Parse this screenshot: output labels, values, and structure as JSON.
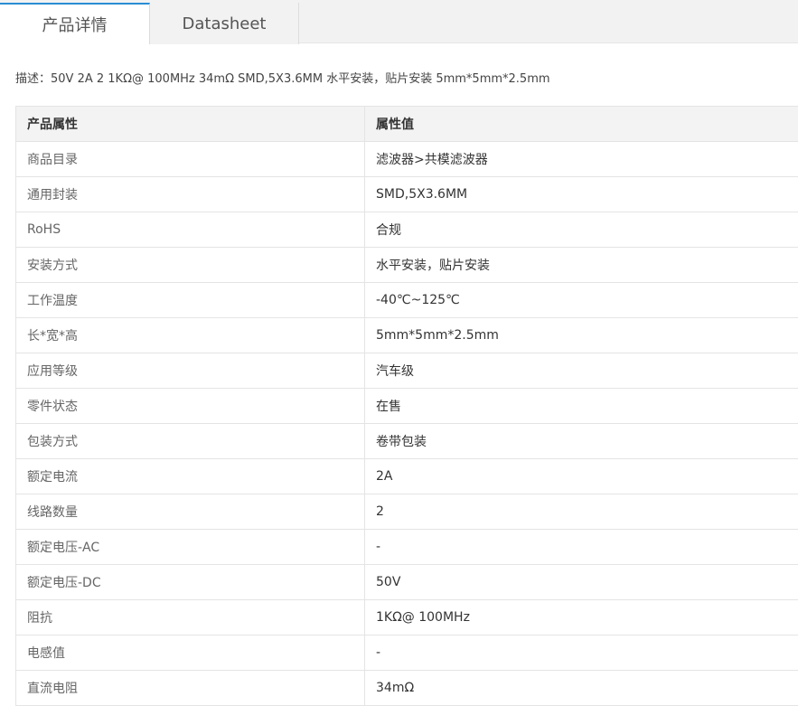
{
  "tabs": {
    "active_label": "产品详情",
    "datasheet_label": "Datasheet"
  },
  "description": "描述：50V 2A 2 1KΩ@ 100MHz 34mΩ SMD,5X3.6MM 水平安装，贴片安装 5mm*5mm*2.5mm",
  "table": {
    "header_key": "产品属性",
    "header_value": "属性值",
    "rows": [
      {
        "key": "商品目录",
        "value": "滤波器>共模滤波器"
      },
      {
        "key": "通用封装",
        "value": "SMD,5X3.6MM"
      },
      {
        "key": "RoHS",
        "value": "合规"
      },
      {
        "key": "安装方式",
        "value": "水平安装，贴片安装"
      },
      {
        "key": "工作温度",
        "value": "-40℃~125℃"
      },
      {
        "key": "长*宽*高",
        "value": "5mm*5mm*2.5mm"
      },
      {
        "key": "应用等级",
        "value": "汽车级"
      },
      {
        "key": "零件状态",
        "value": "在售"
      },
      {
        "key": "包装方式",
        "value": "卷带包装"
      },
      {
        "key": "额定电流",
        "value": "2A"
      },
      {
        "key": "线路数量",
        "value": "2"
      },
      {
        "key": "额定电压-AC",
        "value": "-"
      },
      {
        "key": "额定电压-DC",
        "value": "50V"
      },
      {
        "key": "阻抗",
        "value": "1KΩ@ 100MHz"
      },
      {
        "key": "电感值",
        "value": "-"
      },
      {
        "key": "直流电阻",
        "value": "34mΩ"
      }
    ]
  }
}
